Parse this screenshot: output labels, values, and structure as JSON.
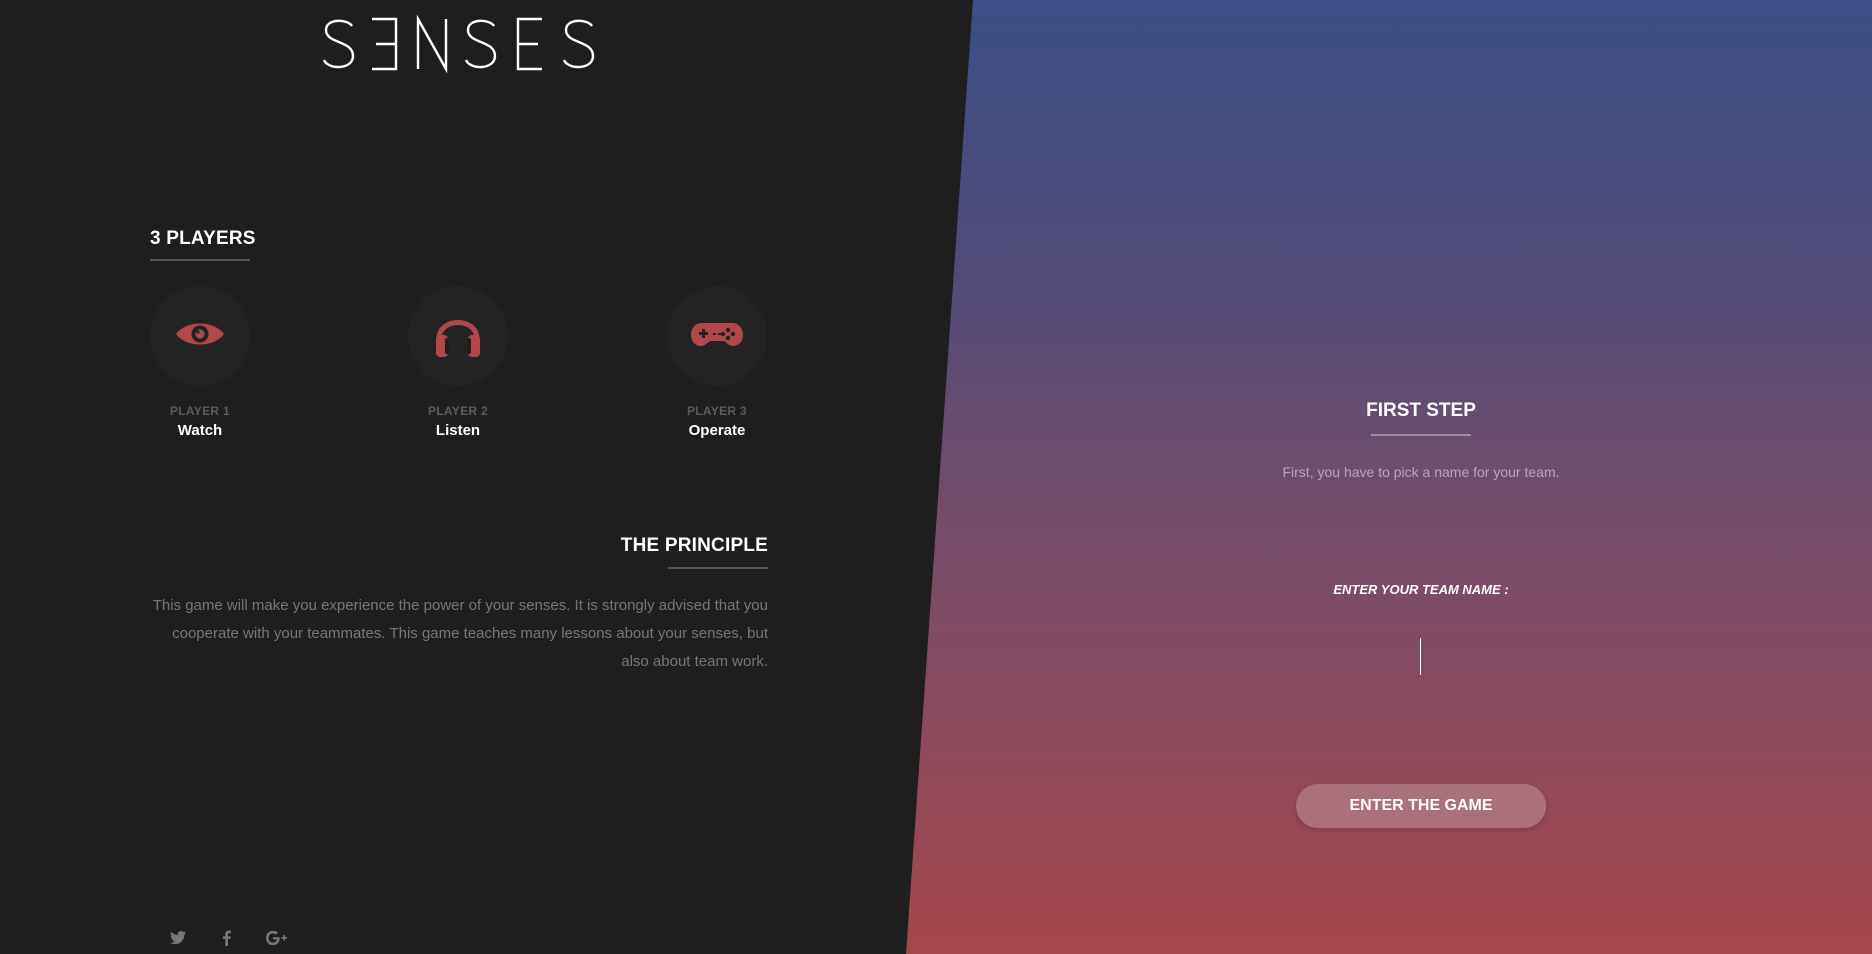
{
  "brand": {
    "logo_text": "SENSES"
  },
  "players_section": {
    "title": "3 PLAYERS",
    "players": [
      {
        "number": "PLAYER 1",
        "role": "Watch",
        "icon": "eye-icon"
      },
      {
        "number": "PLAYER 2",
        "role": "Listen",
        "icon": "headphones-icon"
      },
      {
        "number": "PLAYER 3",
        "role": "Operate",
        "icon": "gamepad-icon"
      }
    ]
  },
  "principle": {
    "title": "THE PRINCIPLE",
    "text": "This game will make you experience the power of your senses. It is strongly advised that you cooperate with your teammates. This game teaches many lessons about your senses, but also about team work."
  },
  "social": [
    "twitter-icon",
    "facebook-icon",
    "google-plus-icon"
  ],
  "first_step": {
    "title": "FIRST STEP",
    "subtitle": "First, you have to pick a name for your team.",
    "input_label": "ENTER YOUR TEAM NAME :",
    "input_value": "",
    "button_label": "ENTER THE GAME"
  },
  "colors": {
    "left_bg": "#1e1e1e",
    "accent_red": "#b2474b",
    "gradient_top": "#3b4f86",
    "gradient_bottom": "#a5464a"
  }
}
